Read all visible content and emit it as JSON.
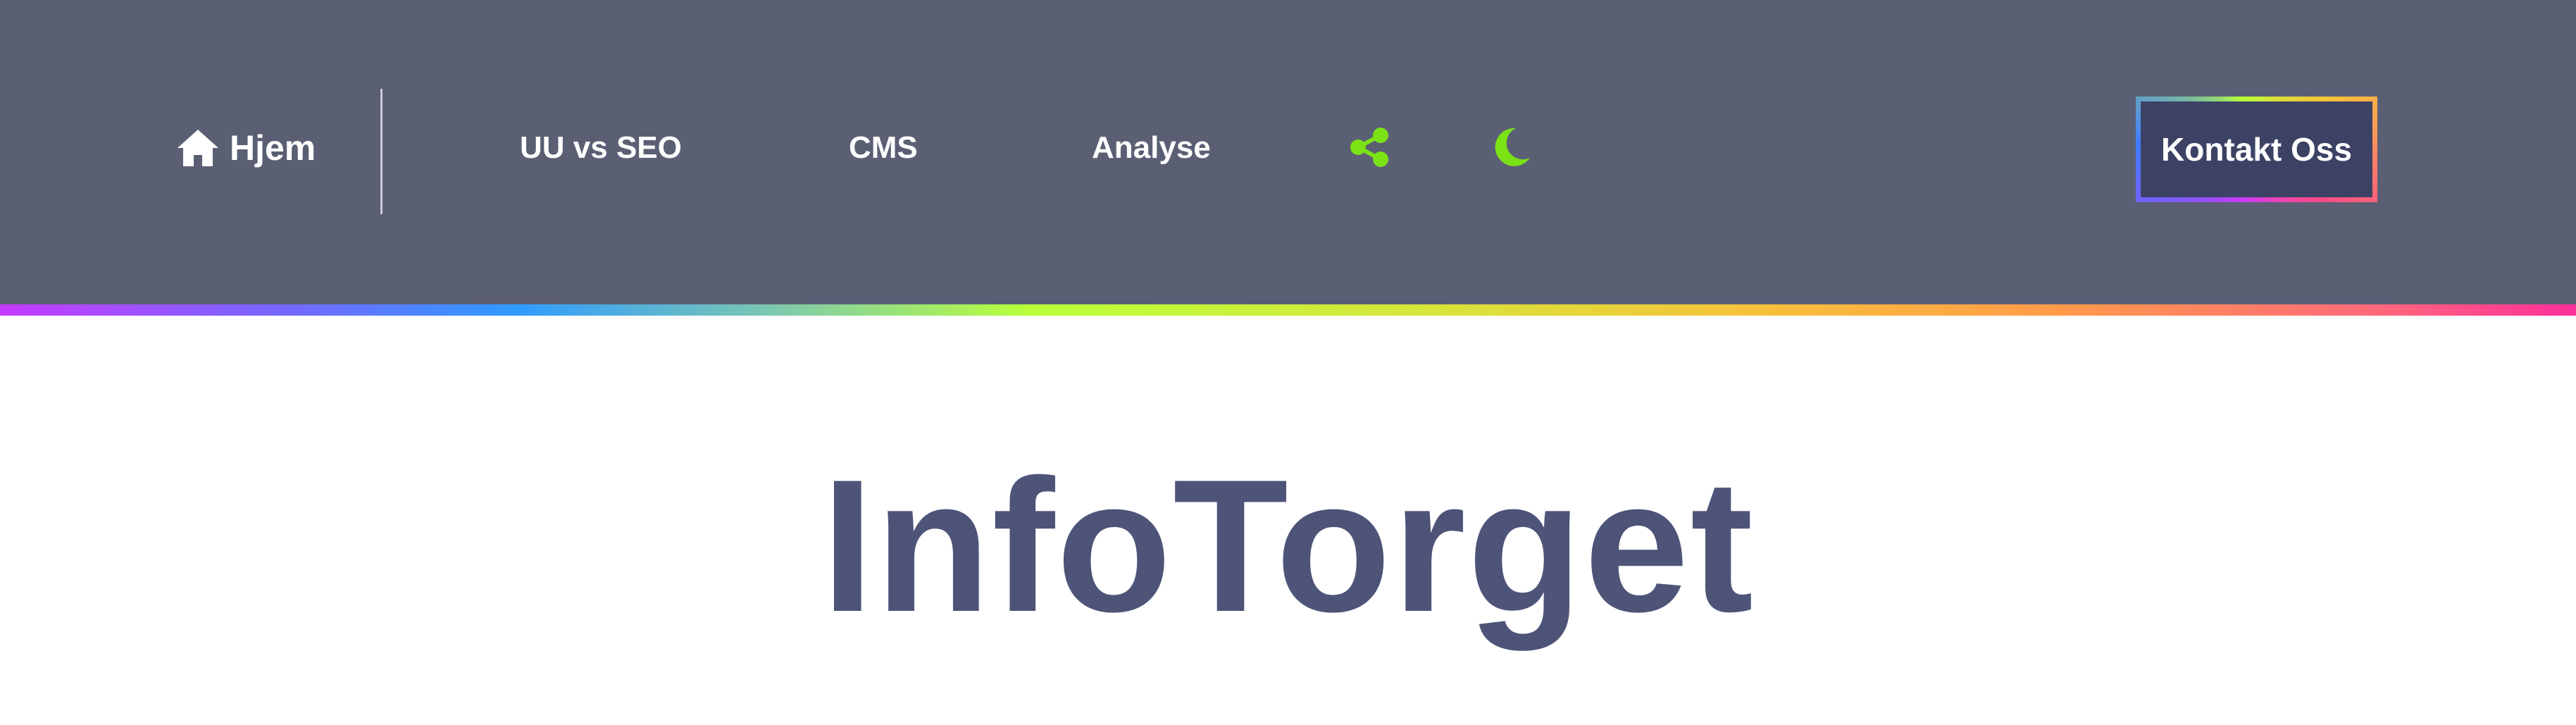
{
  "nav": {
    "home_label": "Hjem",
    "home_icon": "home-icon",
    "items": [
      {
        "label": "UU vs SEO"
      },
      {
        "label": "CMS"
      },
      {
        "label": "Analyse"
      }
    ],
    "share_icon": "share-icon",
    "theme_icon": "moon-icon",
    "contact_label": "Kontakt Oss"
  },
  "colors": {
    "header_bg": "#5a5f74",
    "accent_green": "#7be216",
    "title_color": "#4d5478",
    "contact_bg": "#3c4264"
  },
  "hero": {
    "title": "InfoTorget"
  }
}
